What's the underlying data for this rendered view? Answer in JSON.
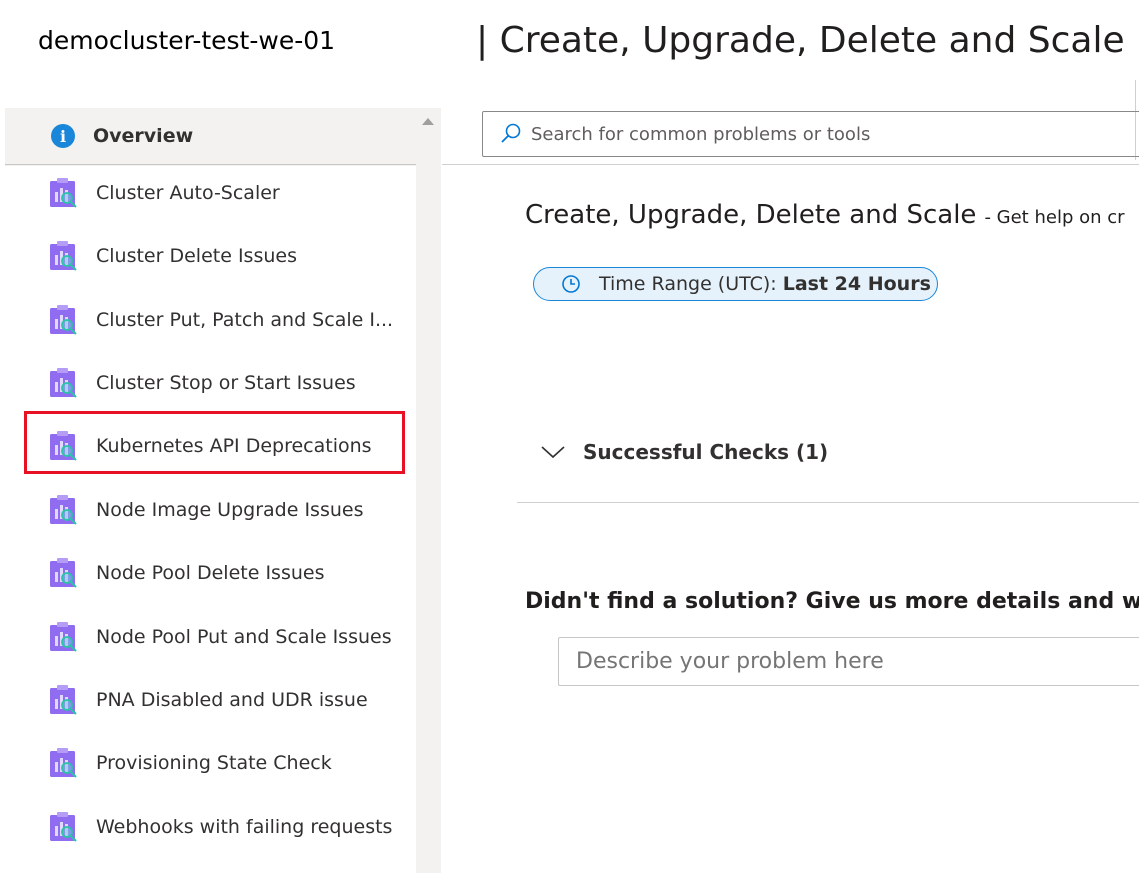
{
  "header": {
    "cluster_name": "democluster-test-we-01",
    "blade_title": "| Create, Upgrade, Delete and Scale"
  },
  "sidebar": {
    "overview": {
      "label": "Overview",
      "icon": "info-icon"
    },
    "items": [
      {
        "label": "Cluster Auto-Scaler",
        "icon": "diagnostic-report-icon"
      },
      {
        "label": "Cluster Delete Issues",
        "icon": "diagnostic-report-icon"
      },
      {
        "label": "Cluster Put, Patch and Scale I...",
        "icon": "diagnostic-report-icon"
      },
      {
        "label": "Cluster Stop or Start Issues",
        "icon": "diagnostic-report-icon"
      },
      {
        "label": "Kubernetes API Deprecations",
        "icon": "diagnostic-report-icon",
        "highlighted": true
      },
      {
        "label": "Node Image Upgrade Issues",
        "icon": "diagnostic-report-icon"
      },
      {
        "label": "Node Pool Delete Issues",
        "icon": "diagnostic-report-icon"
      },
      {
        "label": "Node Pool Put and Scale Issues",
        "icon": "diagnostic-report-icon"
      },
      {
        "label": "PNA Disabled and UDR issue",
        "icon": "diagnostic-report-icon"
      },
      {
        "label": "Provisioning State Check",
        "icon": "diagnostic-report-icon"
      },
      {
        "label": "Webhooks with failing requests",
        "icon": "diagnostic-report-icon"
      }
    ]
  },
  "search": {
    "placeholder": "Search for common problems or tools"
  },
  "main": {
    "title": "Create, Upgrade, Delete and Scale",
    "subtitle": "-  Get help on cr",
    "time_range": {
      "label": "Time Range (UTC): ",
      "value": "Last 24 Hours"
    },
    "successful_checks": "Successful Checks (1)",
    "no_solution": "Didn't find a solution? Give us more details and we'l",
    "describe_placeholder": "Describe your problem here"
  },
  "colors": {
    "accent": "#1a86d9",
    "highlight": "#e81123",
    "icon_purple": "#8f6cf0"
  }
}
